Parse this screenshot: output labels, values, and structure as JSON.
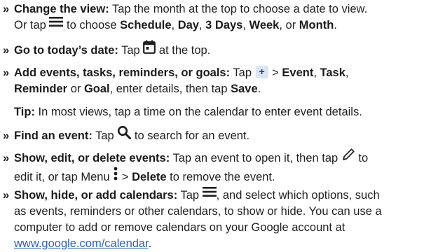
{
  "bullet_glyph": "»",
  "items": [
    {
      "title": "Change the view:",
      "line1_a": " Tap the month at the top to choose a date to view.",
      "line2_a": "Or tap ",
      "line2_b": " to choose ",
      "v1": "Schedule",
      "sep1": ", ",
      "v2": "Day",
      "sep2": ", ",
      "v3": "3 Days",
      "sep3": ", ",
      "v4": "Week",
      "sep4": ", or ",
      "v5": "Month",
      "end": "."
    },
    {
      "title": "Go to today’s date:",
      "text_a": " Tap ",
      "text_b": " at the top."
    },
    {
      "title": "Add events, tasks, reminders, or goals:",
      "text_a": " Tap ",
      "plus": "+",
      "text_b": " > ",
      "o1": "Event",
      "sep1": ", ",
      "o2": "Task",
      "sep2": ",",
      "o3": "Reminder",
      "sep3": " or ",
      "o4": "Goal",
      "text_c": ", enter details, then tap ",
      "o5": "Save",
      "end": "."
    },
    {
      "title": "Tip:",
      "text": " In most views, tap a time on the calendar to enter event details."
    },
    {
      "title": "Find an event:",
      "text_a": " Tap ",
      "text_b": " to search for an event."
    },
    {
      "title": "Show, edit, or delete events:",
      "text_a": " Tap an event to open it, then tap ",
      "text_b": " to",
      "line2_a": "edit it, or tap Menu ",
      "line2_b": " > ",
      "delete": "Delete",
      "line2_c": " to remove the event."
    },
    {
      "title": "Show, hide, or add calendars:",
      "text_a": " Tap ",
      "text_b": ", and select which options, such",
      "line2": "as events, reminders or other calendars, to show or hide. You can use a",
      "line3": "computer to add or remove calendars on your Google account at",
      "link": "www.google.com/calendar",
      "end": "."
    }
  ],
  "colors": {
    "text": "#1f1f1f",
    "link": "#2b5fc7",
    "plus_bg": "#dbe4f2"
  },
  "icons": [
    "menu-icon",
    "calendar-today-icon",
    "plus-icon",
    "search-icon",
    "pencil-icon",
    "more-vert-icon"
  ]
}
